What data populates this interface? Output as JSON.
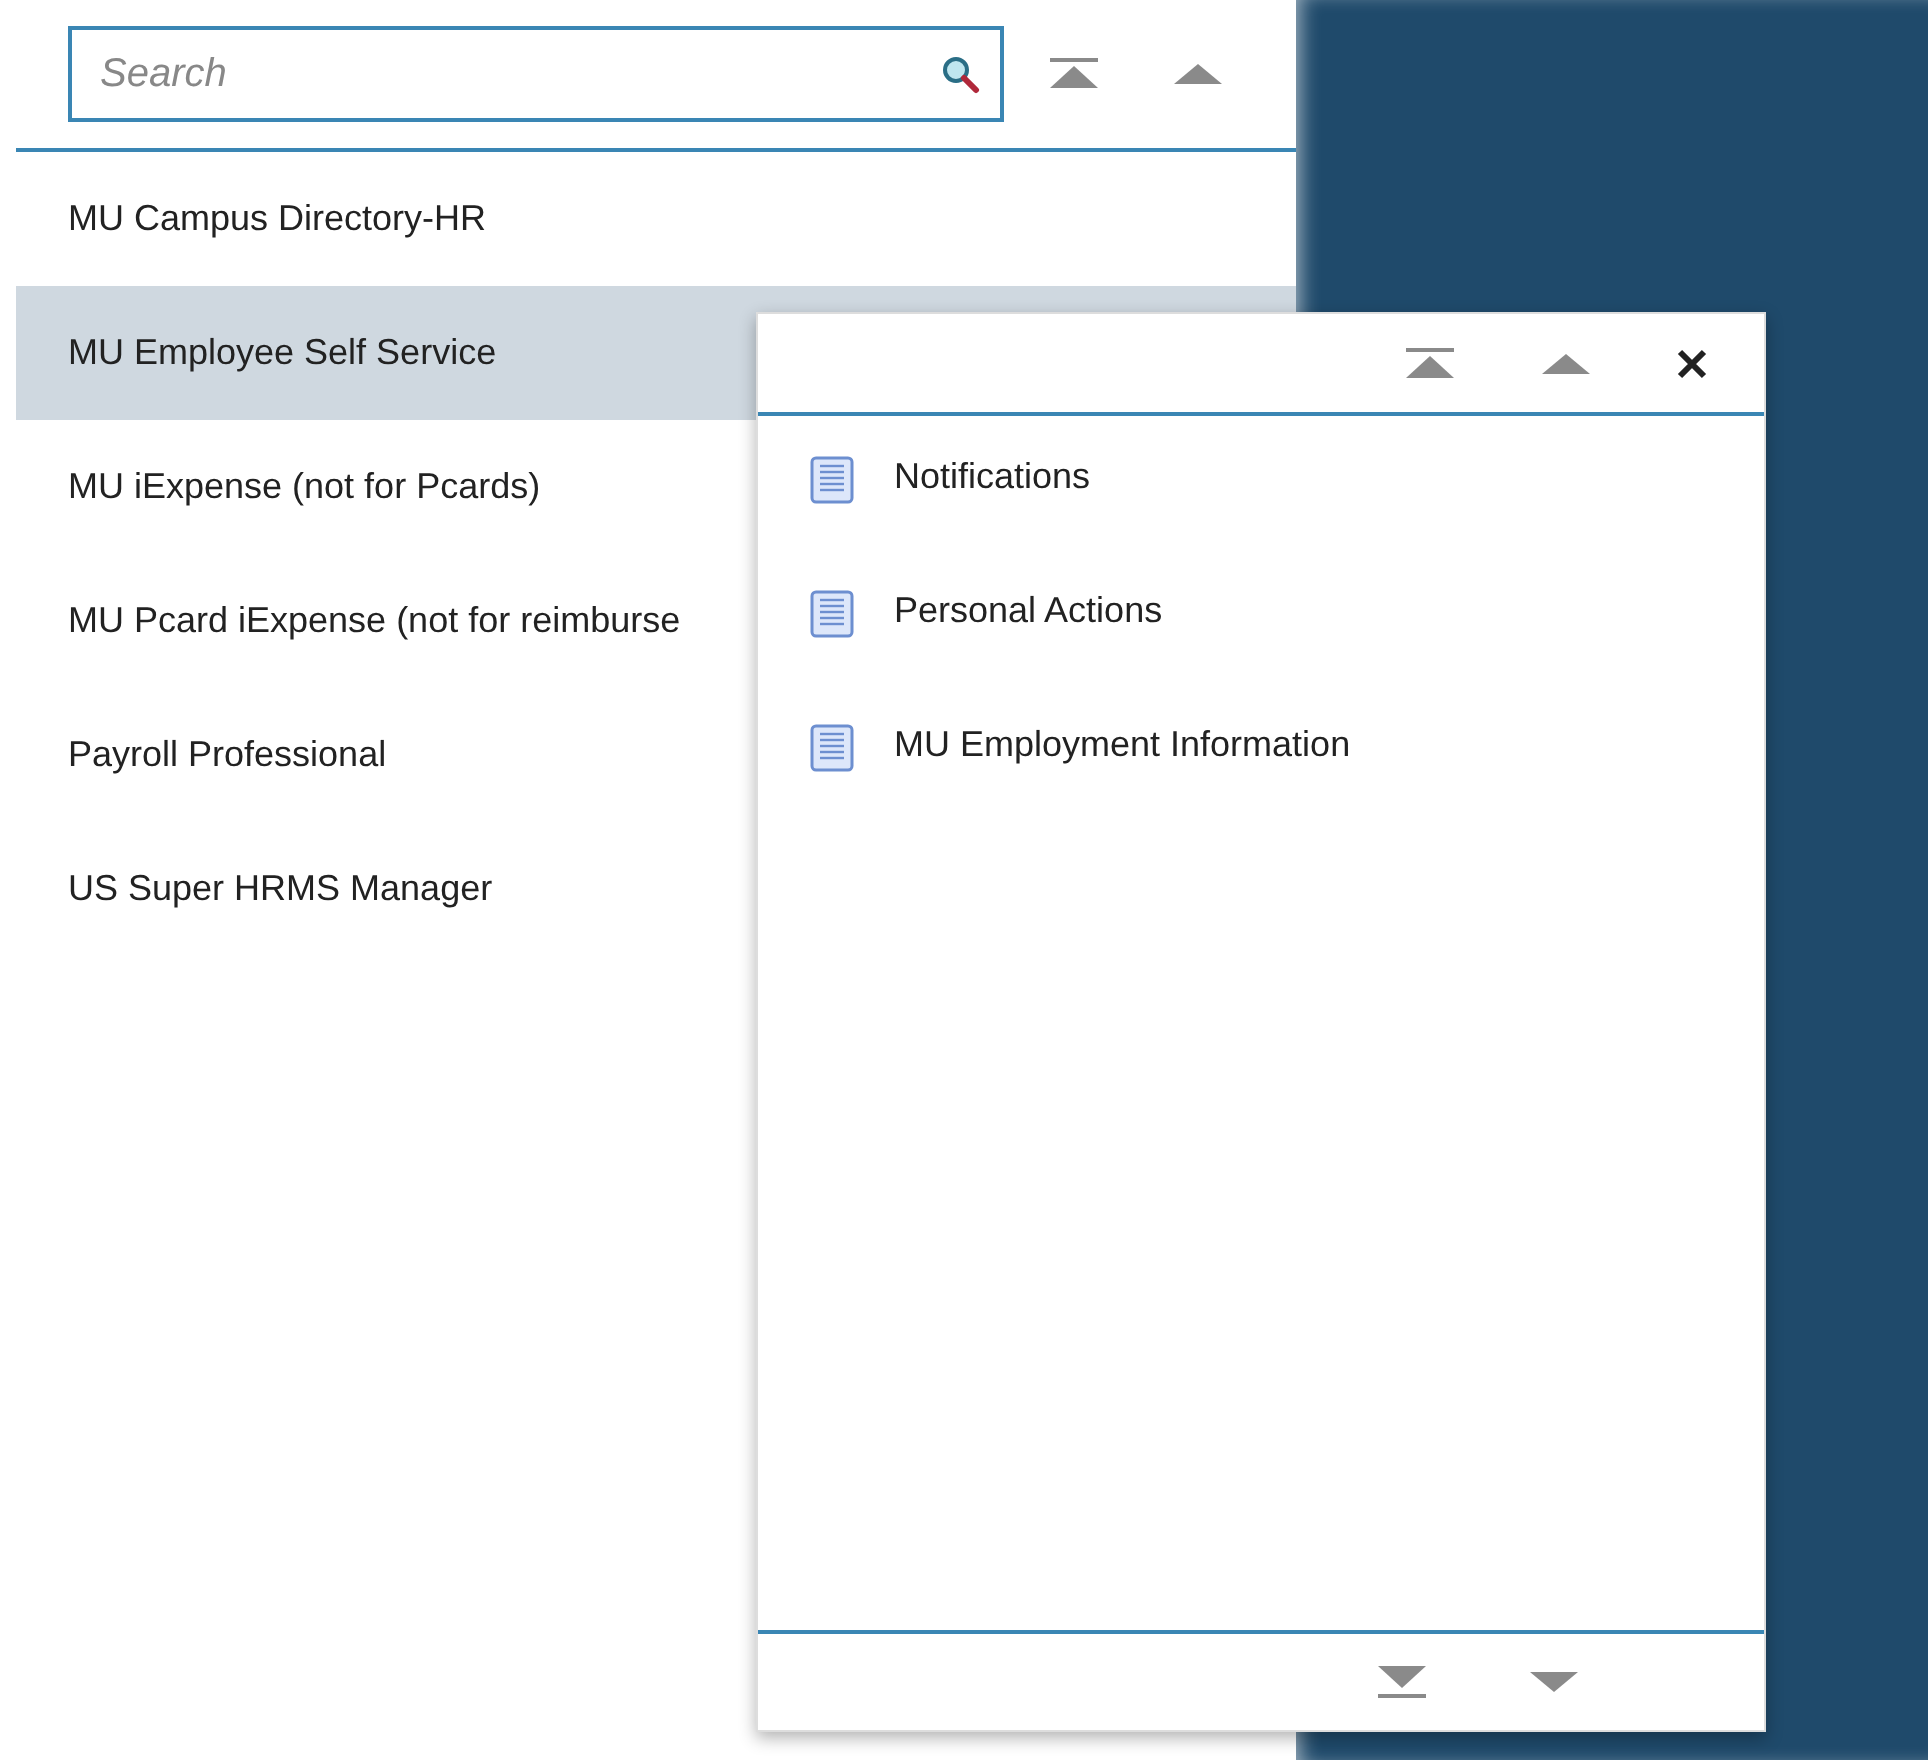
{
  "search": {
    "placeholder": "Search"
  },
  "menu_items": [
    {
      "label": "MU Campus Directory-HR",
      "selected": false
    },
    {
      "label": "MU Employee Self Service",
      "selected": true
    },
    {
      "label": "MU iExpense (not for Pcards)",
      "selected": false
    },
    {
      "label": "MU Pcard iExpense (not for reimburse",
      "selected": false
    },
    {
      "label": "Payroll Professional",
      "selected": false
    },
    {
      "label": "US Super HRMS Manager",
      "selected": false
    }
  ],
  "submenu": {
    "items": [
      {
        "label": "Notifications"
      },
      {
        "label": "Personal Actions"
      },
      {
        "label": "MU Employment Information"
      }
    ]
  }
}
